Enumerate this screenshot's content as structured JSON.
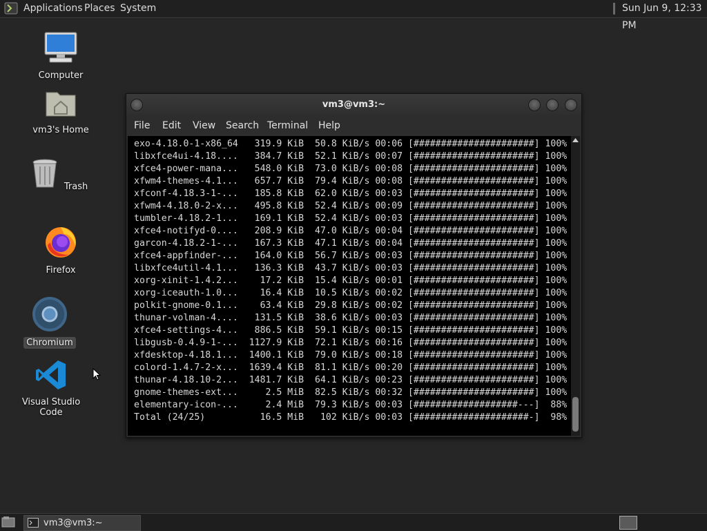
{
  "top_panel": {
    "menus": [
      "Applications",
      "Places",
      "System"
    ],
    "clock": "Sun Jun  9, 12:33 PM"
  },
  "desktop": {
    "icons": [
      {
        "label": "Computer",
        "icon": "computer-icon"
      },
      {
        "label": "vm3's Home",
        "icon": "home-folder-icon"
      },
      {
        "label": "Trash",
        "icon": "trash-icon"
      },
      {
        "label": "Firefox",
        "icon": "firefox-icon"
      },
      {
        "label": "Chromium",
        "icon": "chromium-icon",
        "selected": true
      },
      {
        "label": "Visual Studio Code",
        "icon": "vscode-icon"
      }
    ]
  },
  "terminal": {
    "title": "vm3@vm3:~",
    "menu": [
      "File",
      "Edit",
      "View",
      "Search",
      "Terminal",
      "Help"
    ],
    "lines": [
      "exo-4.18.0-1-x86_64   319.9 KiB  50.8 KiB/s 00:06 [######################] 100%",
      "libxfce4ui-4.18....   384.7 KiB  52.1 KiB/s 00:07 [######################] 100%",
      "xfce4-power-mana...   548.0 KiB  73.0 KiB/s 00:08 [######################] 100%",
      "xfwm4-themes-4.1...   657.7 KiB  79.4 KiB/s 00:08 [######################] 100%",
      "xfconf-4.18.3-1-...   185.8 KiB  62.0 KiB/s 00:03 [######################] 100%",
      "xfwm4-4.18.0-2-x...   495.8 KiB  52.4 KiB/s 00:09 [######################] 100%",
      "tumbler-4.18.2-1...   169.1 KiB  52.4 KiB/s 00:03 [######################] 100%",
      "xfce4-notifyd-0....   208.9 KiB  47.0 KiB/s 00:04 [######################] 100%",
      "garcon-4.18.2-1-...   167.3 KiB  47.1 KiB/s 00:04 [######################] 100%",
      "xfce4-appfinder-...   164.0 KiB  56.7 KiB/s 00:03 [######################] 100%",
      "libxfce4util-4.1...   136.3 KiB  43.7 KiB/s 00:03 [######################] 100%",
      "xorg-xinit-1.4.2...    17.2 KiB  15.4 KiB/s 00:01 [######################] 100%",
      "xorg-iceauth-1.0...    16.4 KiB  10.5 KiB/s 00:02 [######################] 100%",
      "polkit-gnome-0.1...    63.4 KiB  29.8 KiB/s 00:02 [######################] 100%",
      "thunar-volman-4....   131.5 KiB  38.6 KiB/s 00:03 [######################] 100%",
      "xfce4-settings-4...   886.5 KiB  59.1 KiB/s 00:15 [######################] 100%",
      "libgusb-0.4.9-1-...  1127.9 KiB  72.1 KiB/s 00:16 [######################] 100%",
      "xfdesktop-4.18.1...  1400.1 KiB  79.0 KiB/s 00:18 [######################] 100%",
      "colord-1.4.7-2-x...  1639.4 KiB  81.1 KiB/s 00:20 [######################] 100%",
      "thunar-4.18.10-2...  1481.7 KiB  64.1 KiB/s 00:23 [######################] 100%",
      "gnome-themes-ext...     2.5 MiB  82.5 KiB/s 00:32 [######################] 100%",
      "elementary-icon-...     2.4 MiB  79.3 KiB/s 00:03 [###################---]  88%",
      "Total (24/25)          16.5 MiB   102 KiB/s 00:03 [#####################-]  98%"
    ]
  },
  "taskbar": {
    "window_label": "vm3@vm3:~"
  }
}
